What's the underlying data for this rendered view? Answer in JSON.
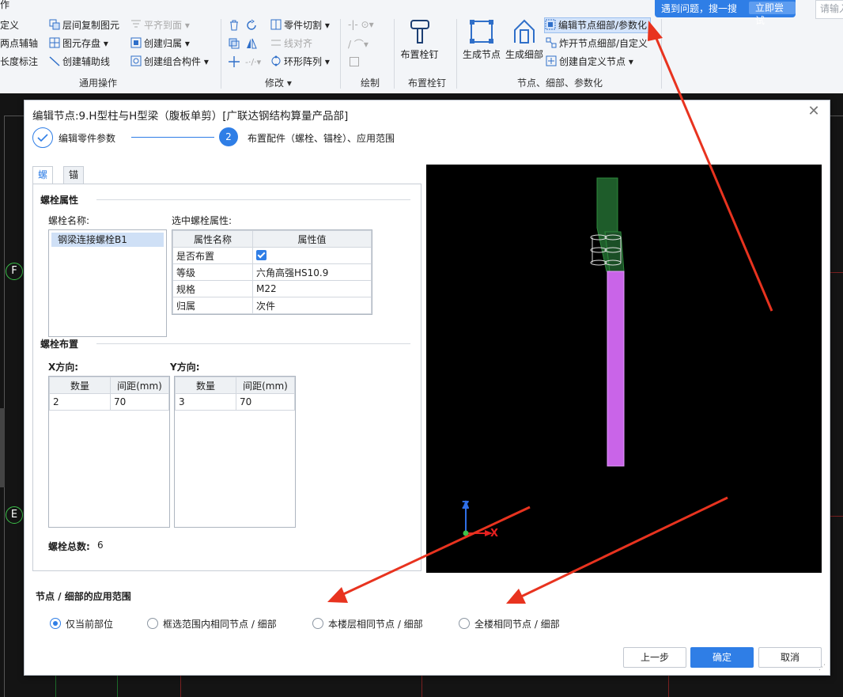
{
  "ribbon": {
    "col1": [
      "定义",
      "两点辅轴",
      "长度标注"
    ],
    "col2": [
      "层间复制图元",
      "图元存盘",
      "创建辅助线"
    ],
    "col3": [
      "平齐到面",
      "创建归属",
      "创建组合构件"
    ],
    "col4": [
      "零件切割",
      "线对齐",
      "环形阵列"
    ],
    "top_left": "作",
    "groups": {
      "common": "通用操作",
      "modify": "修改",
      "draw": "绘制",
      "bolt": "布置栓钉",
      "node": "节点、细部、参数化"
    },
    "bolt_btn": "布置栓钉",
    "gen_node": "生成节点",
    "gen_detail": "生成细部",
    "node_cmds": [
      "编辑节点细部/参数化",
      "炸开节点细部/自定义",
      "创建自定义节点"
    ]
  },
  "tip": {
    "text": "遇到问题，搜一搜",
    "button": "立即尝试"
  },
  "search": {
    "placeholder": "请输入"
  },
  "axes": [
    "F",
    "E"
  ],
  "dialog": {
    "title": "编辑节点:9.H型柱与H型梁（腹板单剪）[广联达钢结构算量产品部]",
    "steps": [
      {
        "label": "编辑零件参数"
      },
      {
        "number": "2",
        "label": "布置配件（螺栓、锚栓）、应用范围"
      }
    ],
    "tabs": [
      "螺栓",
      "锚栓"
    ],
    "bolt_props_title": "螺栓属性",
    "bolt_name_label": "螺栓名称:",
    "bolt_names": [
      "钢梁连接螺栓B1"
    ],
    "selected_props_label": "选中螺栓属性:",
    "prop_headers": [
      "属性名称",
      "属性值"
    ],
    "props": [
      {
        "name": "是否布置",
        "value": ""
      },
      {
        "name": "等级",
        "value": "六角高强HS10.9"
      },
      {
        "name": "规格",
        "value": "M22"
      },
      {
        "name": "归属",
        "value": "次件"
      }
    ],
    "layout_title": "螺栓布置",
    "x_dir": {
      "label": "X方向:",
      "headers": [
        "数量",
        "间距(mm)"
      ],
      "rows": [
        [
          "2",
          "70"
        ]
      ]
    },
    "y_dir": {
      "label": "Y方向:",
      "headers": [
        "数量",
        "间距(mm)"
      ],
      "rows": [
        [
          "3",
          "70"
        ]
      ]
    },
    "total_label": "螺栓总数:",
    "total_value": "6",
    "scope_title": "节点 / 细部的应用范围",
    "scope_options": [
      "仅当前部位",
      "框选范围内相同节点 / 细部",
      "本楼层相同节点 / 细部",
      "全楼相同节点 / 细部"
    ],
    "scope_selected": 0,
    "buttons": {
      "prev": "上一步",
      "ok": "确定",
      "cancel": "取消"
    }
  },
  "viewport": {
    "axis_z": "Z",
    "axis_x": "X"
  },
  "colors": {
    "accent": "#2f7ee6",
    "beam": "#c964e8",
    "plate": "#1e5c2a",
    "arrow": "#e8331f"
  }
}
